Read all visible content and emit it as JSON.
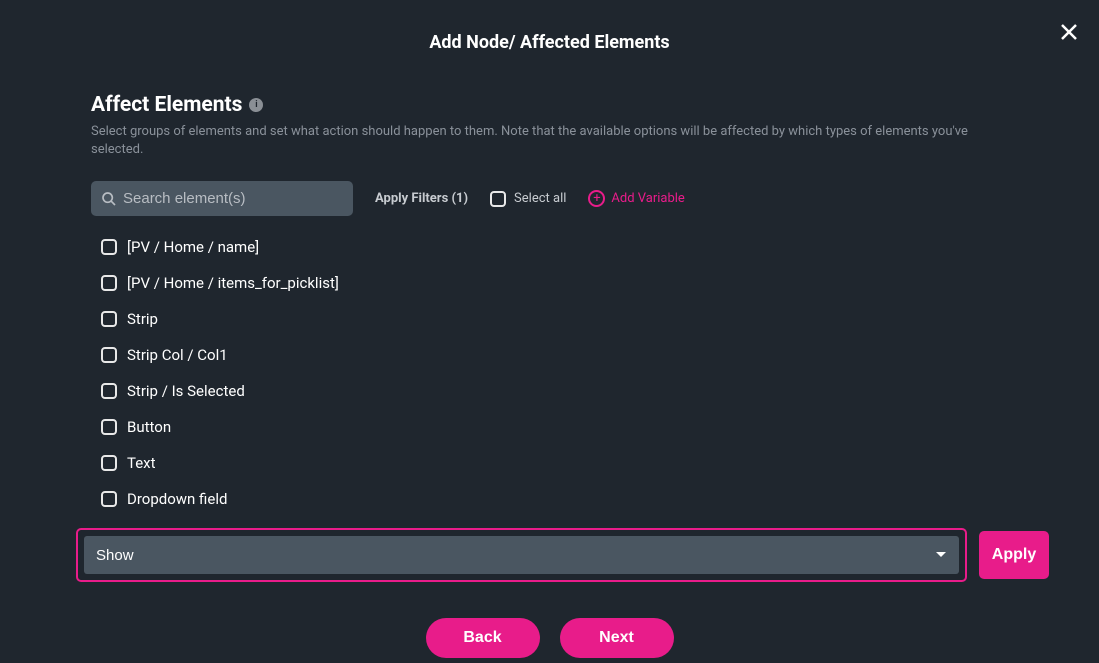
{
  "modal": {
    "title": "Add Node/ Affected Elements",
    "section_title": "Affect Elements",
    "section_desc": "Select groups of elements and set what action should happen to them. Note that the available options will be affected by which types of elements you've selected."
  },
  "filters": {
    "search_placeholder": "Search element(s)",
    "apply_filters_label": "Apply Filters (1)",
    "select_all_label": "Select all",
    "add_variable_label": "Add Variable"
  },
  "elements": [
    {
      "label": "[PV / Home / name]"
    },
    {
      "label": "[PV / Home / items_for_picklist]"
    },
    {
      "label": "Strip"
    },
    {
      "label": "Strip Col / Col1"
    },
    {
      "label": "Strip / Is Selected"
    },
    {
      "label": "Button"
    },
    {
      "label": "Text"
    },
    {
      "label": "Dropdown field"
    }
  ],
  "action": {
    "selected": "Show",
    "apply_label": "Apply"
  },
  "footer": {
    "back_label": "Back",
    "next_label": "Next"
  },
  "colors": {
    "accent": "#e81c8a"
  }
}
